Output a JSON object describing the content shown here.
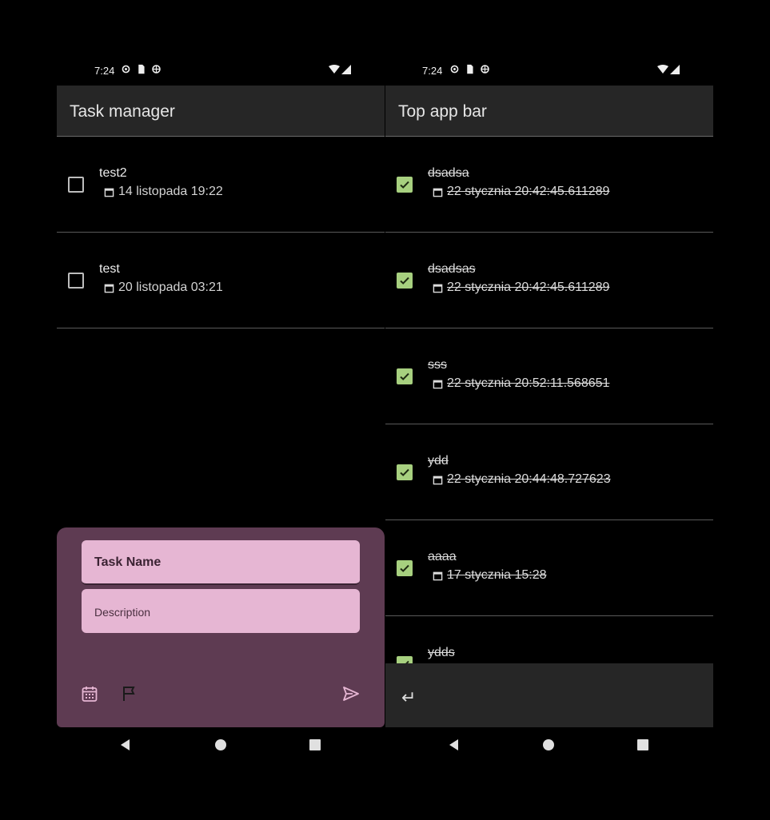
{
  "left_phone": {
    "status_time": "7:24",
    "app_title": "Task manager",
    "tasks": [
      {
        "name": "test2",
        "date": "14 listopada 19:22",
        "checked": false
      },
      {
        "name": "test",
        "date": "20 listopada 03:21",
        "checked": false
      }
    ],
    "sheet": {
      "task_name_placeholder": "Task Name",
      "description_placeholder": "Description",
      "icons": [
        "calendar-icon",
        "flag-icon",
        "send-icon"
      ]
    }
  },
  "right_phone": {
    "status_time": "7:24",
    "app_title": "Top app bar",
    "tasks": [
      {
        "name": "dsadsa",
        "date": "22 stycznia  20:42:45.611289",
        "checked": true
      },
      {
        "name": "dsadsas",
        "date": "22 stycznia  20:42:45.611289",
        "checked": true
      },
      {
        "name": "sss",
        "date": "22 stycznia  20:52:11.568651",
        "checked": true
      },
      {
        "name": "ydd",
        "date": "22 stycznia  20:44:48.727623",
        "checked": true
      },
      {
        "name": "aaaa",
        "date": "17 stycznia  15:28",
        "checked": true
      },
      {
        "name": "ydds",
        "date": "",
        "checked": true
      }
    ],
    "input_icon": "enter-icon",
    "input_glyph": "↵"
  },
  "colors": {
    "background": "#000000",
    "app_bar": "#262626",
    "sheet": "#5e3b52",
    "field": "#e6b6d3",
    "checkbox_checked": "#a7d07f"
  }
}
